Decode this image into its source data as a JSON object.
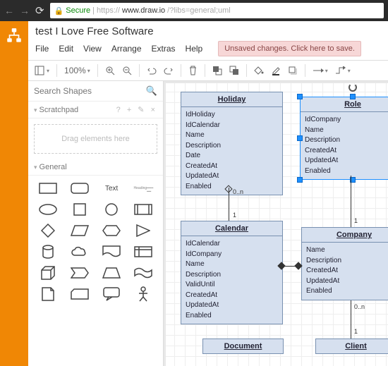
{
  "browser": {
    "secure": "Secure",
    "url_prefix": "https://",
    "url_host": "www.draw.io",
    "url_path": "/?libs=general;uml"
  },
  "app": {
    "title": "test I Love Free Software",
    "menus": [
      "File",
      "Edit",
      "View",
      "Arrange",
      "Extras",
      "Help"
    ],
    "save_warning": "Unsaved changes. Click here to save."
  },
  "toolbar": {
    "zoom": "100%"
  },
  "sidebar": {
    "search_placeholder": "Search Shapes",
    "scratchpad": "Scratchpad",
    "scratchpad_tools": "? + ✎ ×",
    "dropzone": "Drag elements here",
    "general": "General",
    "text_label": "Text",
    "heading_label": "Heading"
  },
  "uml": {
    "holiday": {
      "title": "Holiday",
      "attrs": [
        "IdHoliday",
        "IdCalendar",
        "Name",
        "Description",
        "Date",
        "CreatedAt",
        "UpdatedAt",
        "Enabled"
      ]
    },
    "role": {
      "title": "Role",
      "attrs": [
        "IdCompany",
        "Name",
        "Description",
        "CreatedAt",
        "UpdatedAt",
        "Enabled"
      ]
    },
    "calendar": {
      "title": "Calendar",
      "attrs": [
        "IdCalendar",
        "IdCompany",
        "Name",
        "Description",
        "ValidUntil",
        "CreatedAt",
        "UpdatedAt",
        "Enabled"
      ]
    },
    "company": {
      "title": "Company",
      "attrs": [
        "Name",
        "Description",
        "CreatedAt",
        "UpdatedAt",
        "Enabled"
      ]
    },
    "document": {
      "title": "Document"
    },
    "client": {
      "title": "Client"
    }
  },
  "cardinality": {
    "zero_n": "0..n",
    "one": "1"
  }
}
